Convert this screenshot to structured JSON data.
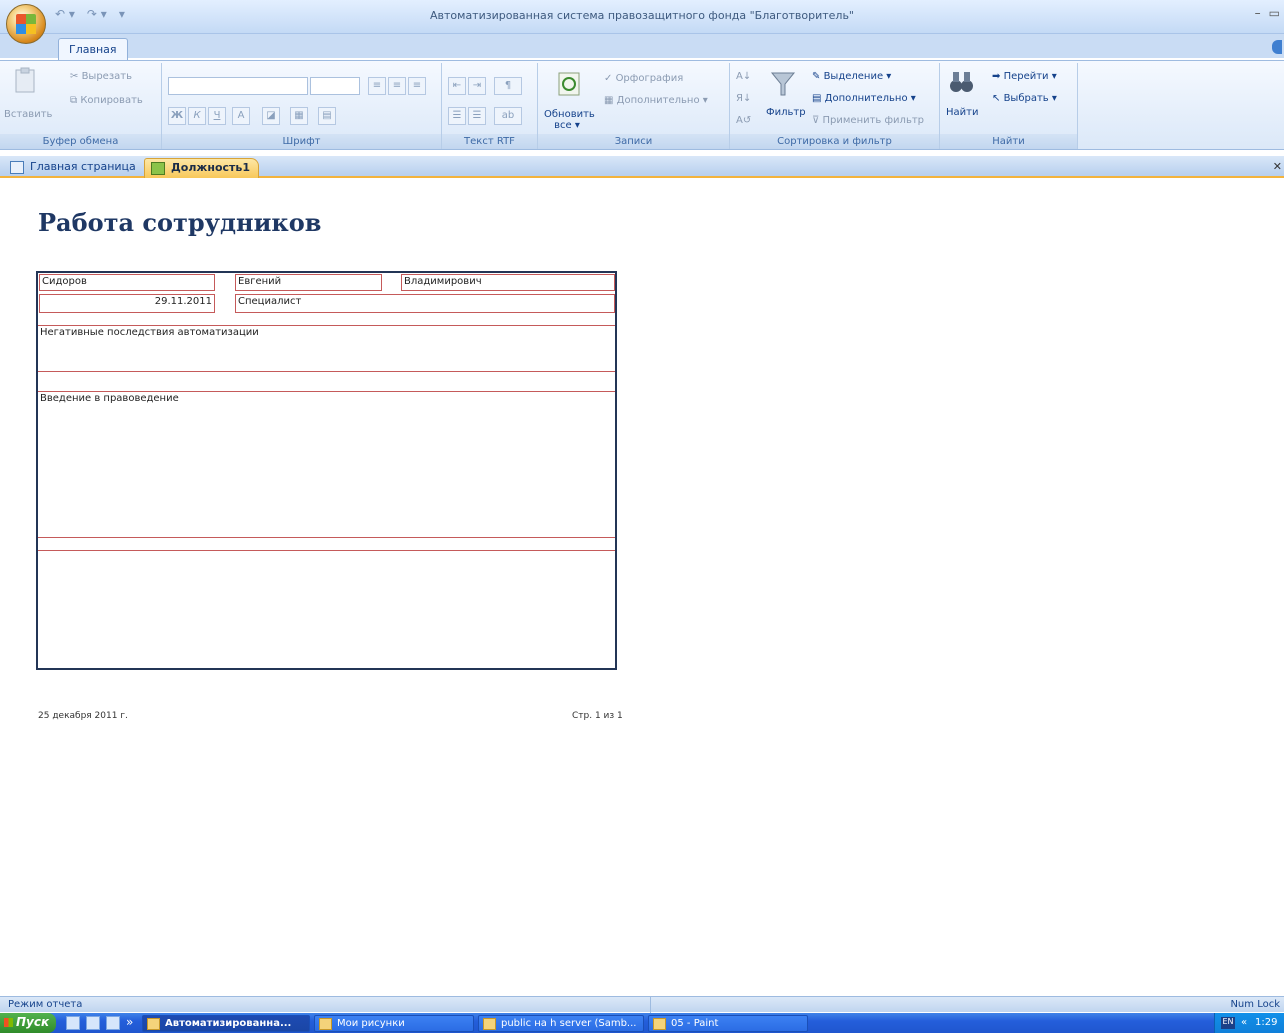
{
  "window": {
    "title": "Автоматизированная система правозащитного фонда \"Благотворитель\"",
    "controls": [
      "–",
      "▭"
    ]
  },
  "ribbon": {
    "home_tab": "Главная",
    "clipboard": {
      "label": "Буфер обмена",
      "paste": "Вставить",
      "cut": "Вырезать",
      "copy": "Копировать"
    },
    "font": {
      "label": "Шрифт",
      "bold": "Ж",
      "italic": "К",
      "underline": "Ч",
      "font_color": "A"
    },
    "rtf": {
      "label": "Текст RTF"
    },
    "records": {
      "label": "Записи",
      "refresh": "Обновить",
      "refresh_sub": "все ▾",
      "spelling": "Орфография",
      "more": "Дополнительно ▾"
    },
    "sort": {
      "label": "Сортировка и фильтр",
      "filter": "Фильтр",
      "selection": "Выделение ▾",
      "advanced": "Дополнительно ▾",
      "apply": "Применить фильтр"
    },
    "find": {
      "label": "Найти",
      "find_btn": "Найти",
      "goto": "Перейти ▾",
      "select": "Выбрать ▾"
    }
  },
  "doc_tabs": [
    {
      "label": "Главная страница"
    },
    {
      "label": "Должность1"
    }
  ],
  "report": {
    "title": "Работа сотрудников",
    "last_name": "Сидоров",
    "first_name": "Евгений",
    "patronymic": "Владимирович",
    "date": "29.11.2011",
    "position": "Специалист",
    "field1": "Негативные последствия автоматизации",
    "field2": "Введение в правоведение",
    "footer_date": "25 декабря 2011 г.",
    "footer_page": "Стр. 1 из 1"
  },
  "status": {
    "mode": "Режим отчета",
    "numlock": "Num Lock"
  },
  "taskbar": {
    "start": "Пуск",
    "more": "»",
    "items": [
      "Автоматизированна...",
      "Мои рисунки",
      "public на h server (Samb...",
      "05 - Paint"
    ],
    "lang": "EN",
    "tray_arrow": "«",
    "clock": "1:29"
  },
  "colors": {
    "report_title": "#1f3864",
    "field_border": "#c55a5a",
    "active_tab": "#f8c85a"
  }
}
